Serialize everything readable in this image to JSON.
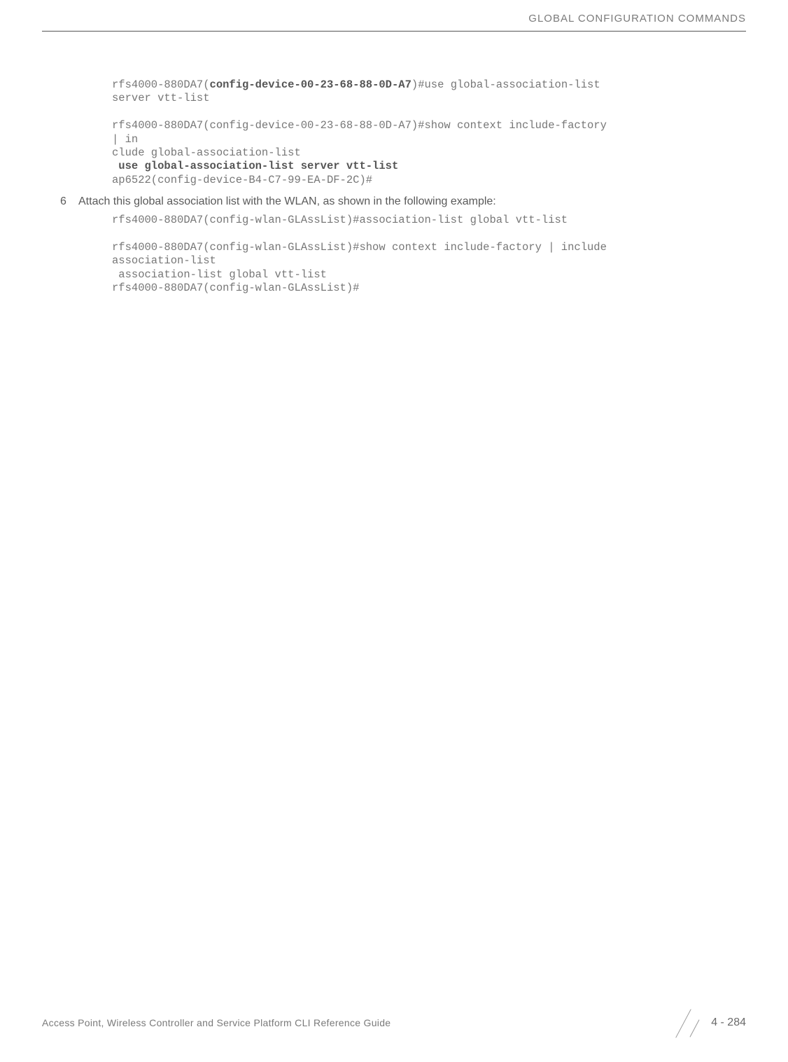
{
  "header": {
    "title": "GLOBAL CONFIGURATION COMMANDS"
  },
  "code1": {
    "line1_prefix": "rfs4000-880DA7(",
    "line1_bold": "config-device-00-23-68-88-0D-A7",
    "line1_suffix": ")#use global-association-list ",
    "line2": "server vtt-list",
    "line3": "",
    "line4": "rfs4000-880DA7(config-device-00-23-68-88-0D-A7)#show context include-factory ",
    "line5": "| in",
    "line6": "clude global-association-list",
    "line7_bold": " use global-association-list server vtt-list",
    "line8": "ap6522(config-device-B4-C7-99-EA-DF-2C)#"
  },
  "step6": {
    "num": "6",
    "text": "Attach this global association list with the WLAN, as shown in the following example:"
  },
  "code2": {
    "line1": "rfs4000-880DA7(config-wlan-GLAssList)#association-list global vtt-list",
    "line2": "",
    "line3": "rfs4000-880DA7(config-wlan-GLAssList)#show context include-factory | include ",
    "line4": "association-list",
    "line5": " association-list global vtt-list",
    "line6": "rfs4000-880DA7(config-wlan-GLAssList)#"
  },
  "footer": {
    "left": "Access Point, Wireless Controller and Service Platform CLI Reference Guide",
    "right": "4 - 284"
  }
}
